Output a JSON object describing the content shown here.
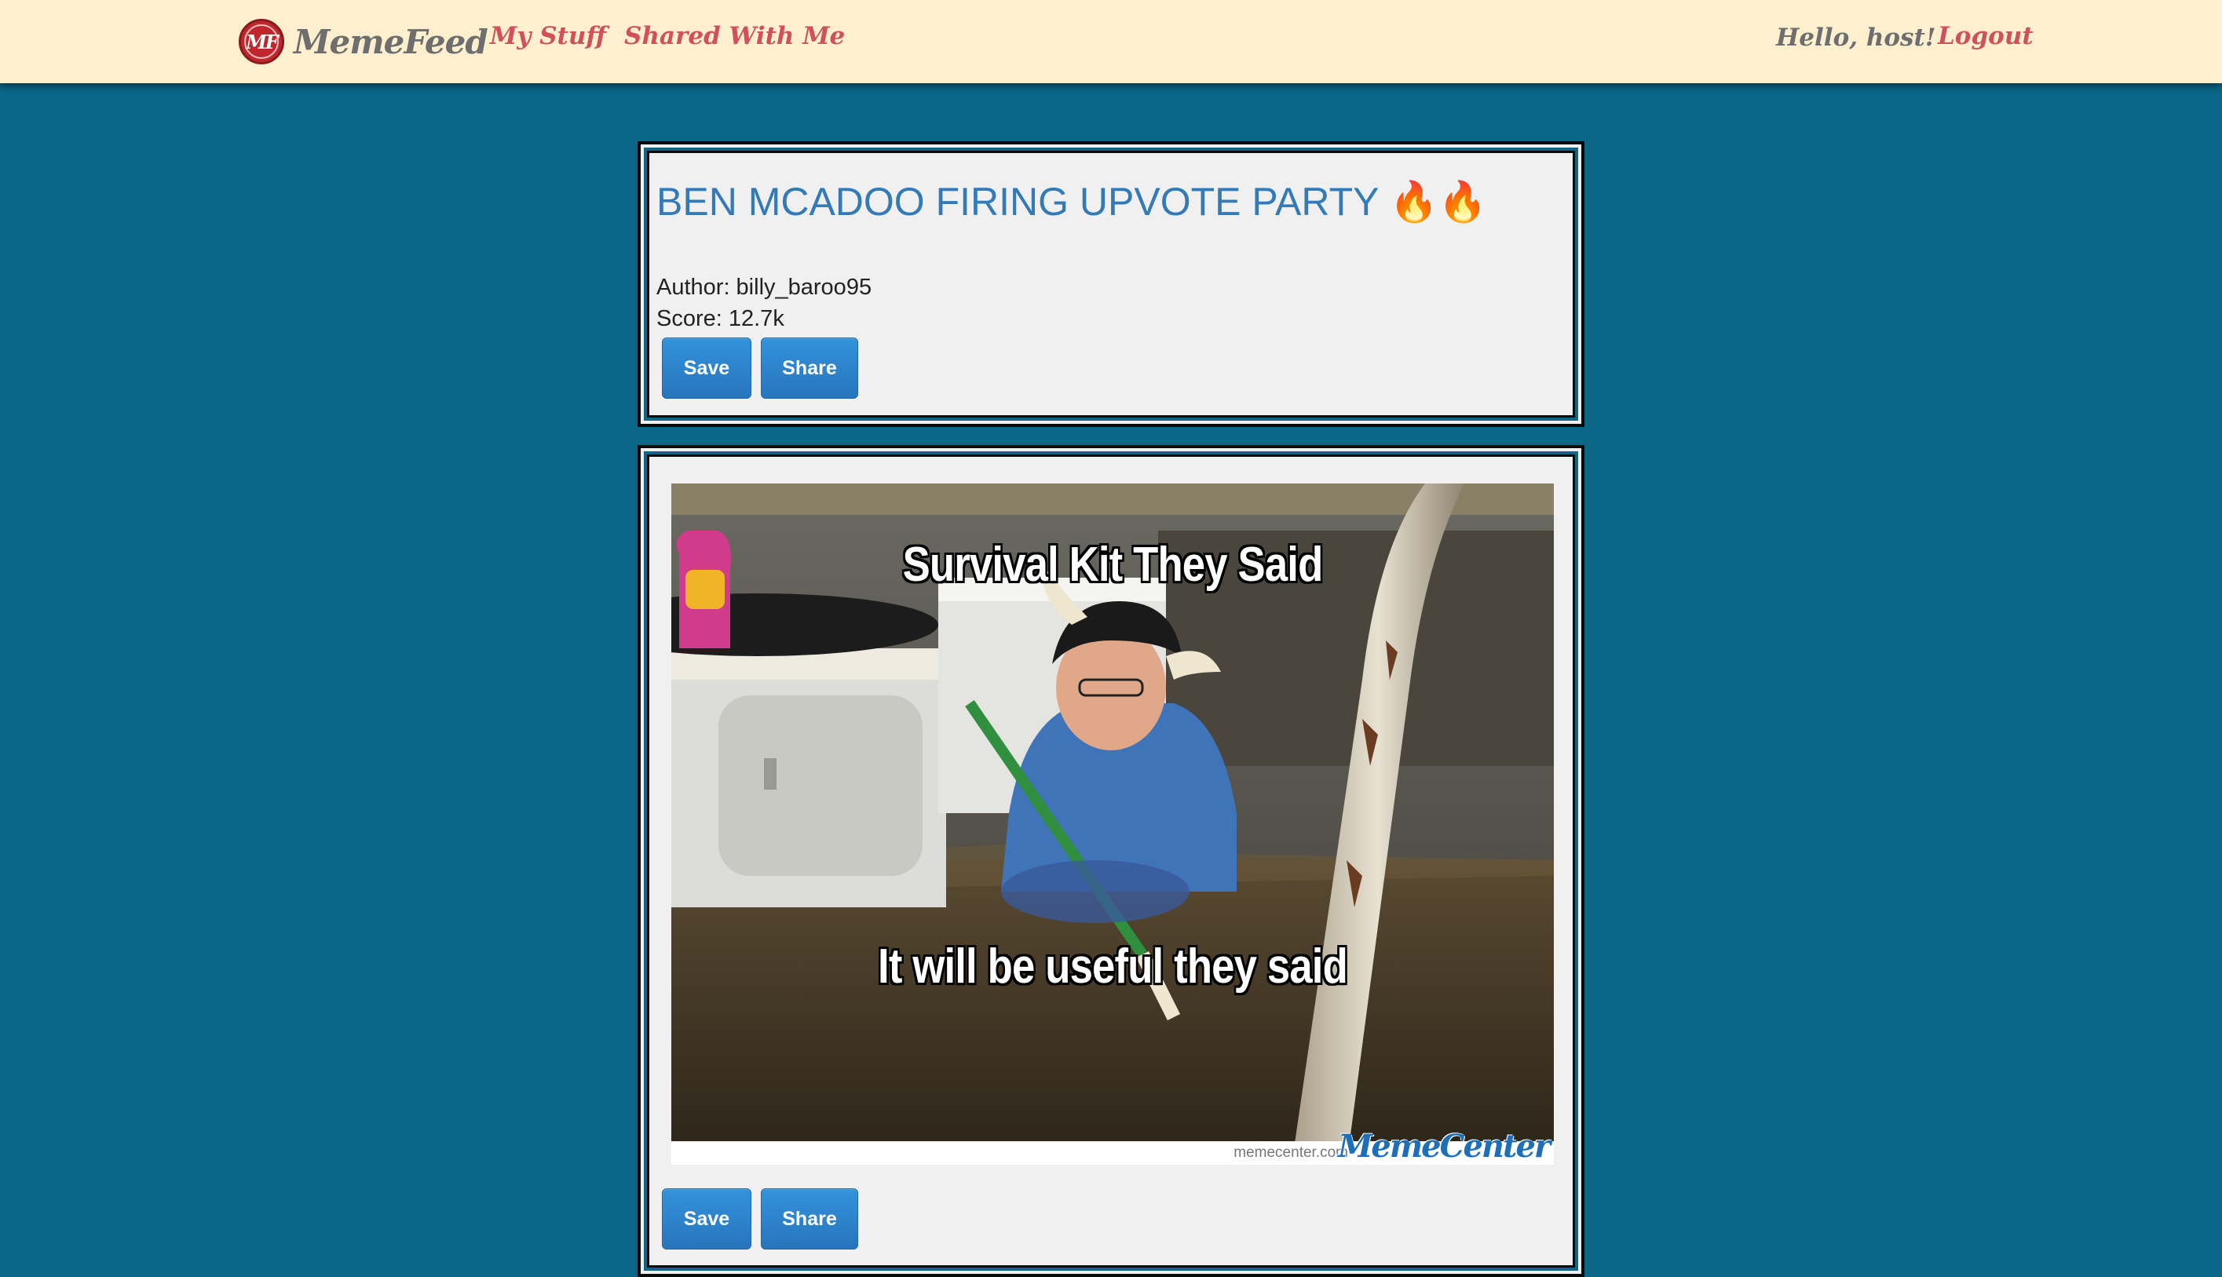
{
  "nav": {
    "brand_logo_text": "MF",
    "brand_name": "MemeFeed",
    "links": [
      {
        "label": "My Stuff"
      },
      {
        "label": "Shared With Me"
      }
    ],
    "greeting": "Hello, host!",
    "logout_label": "Logout"
  },
  "post": {
    "title": "BEN MCADOO FIRING UPVOTE PARTY 🔥🔥",
    "author_line": "Author: billy_baroo95",
    "score_line": "Score: 12.7k",
    "save_label": "Save",
    "share_label": "Share"
  },
  "meme": {
    "top_caption": "Survival Kit They Said",
    "bottom_caption": "It will be useful they said",
    "watermark": "memecenter.com",
    "logo_text": "MemeCenter",
    "save_label": "Save",
    "share_label": "Share"
  },
  "colors": {
    "background": "#0b6688",
    "navbar": "#fef0cf",
    "brand_text": "#6e6e6e",
    "nav_link": "#d0505c",
    "title_blue": "#337ab7",
    "button_blue": "#2f86d0"
  }
}
